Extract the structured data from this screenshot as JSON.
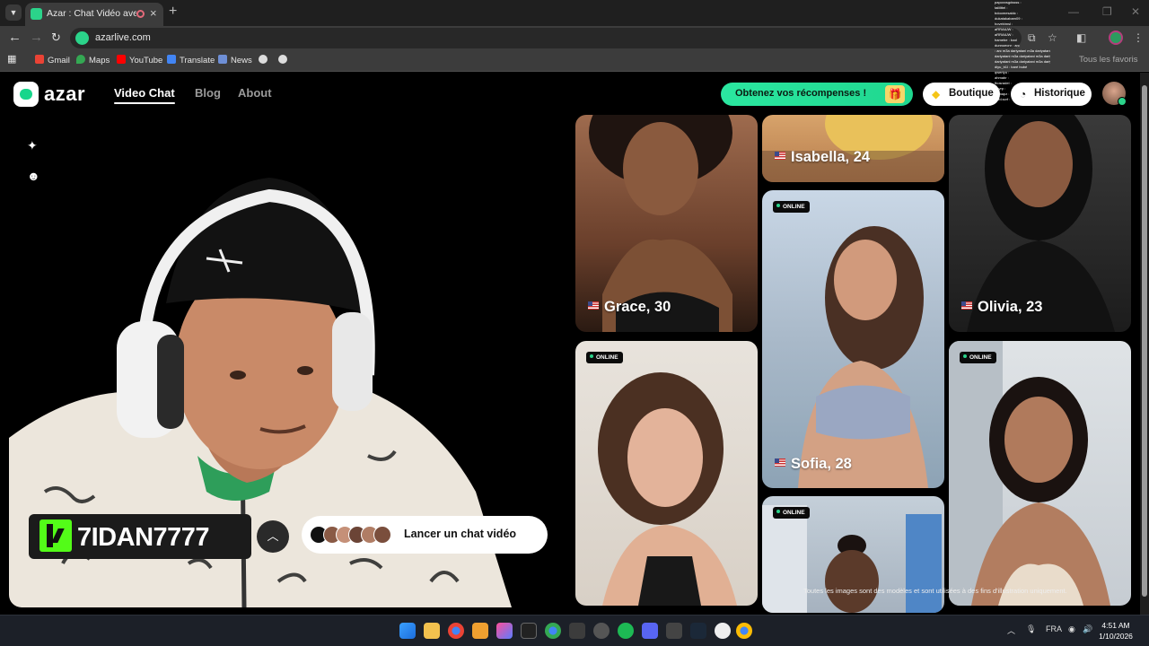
{
  "browser": {
    "tab_title": "Azar : Chat Vidéo avec de n",
    "url": "azarlive.com",
    "bookmarks": [
      "Gmail",
      "Maps",
      "YouTube",
      "Translate",
      "News"
    ],
    "bookmarks_right": "Tous les favoris"
  },
  "chat_overlay": [
    "papoxxsgdssss : ",
    "taiiilttel : ",
    "bdoomesaldc : ",
    "dukatakabam09 : ",
    "hovebimsl : ",
    "aRRAtUW : ",
    "aRRAtUW : ",
    "hamebe : kool",
    "dunnoecnr : arc",
    "          : arc m3a dariyatani m3a dariyatani m3a dariyatani m3a",
    "dariyatani m3a dariyatani m3a dariyatani m3a dariyatani m3a",
    "dariyatani m3a dariyatani m3a dariyatani m3a dariyatani",
    "diyu_b1l : baré bubé",
    "qwertyu : ",
    "ahmabr : ",
    "fbosradel : ",
    "boyrp : ",
    "anmapz : ",
    "atifd.scrf : "
  ],
  "site": {
    "logo_text": "azar",
    "nav": [
      "Video Chat",
      "Blog",
      "About"
    ],
    "rewards_label": "Obtenez vos récompenses !",
    "shop_label": "Boutique",
    "history_label": "Historique",
    "streamer_name": "7IDAN7777",
    "launch_label": "Lancer un chat vidéo",
    "disclaimer": "Toutes les images sont des modèles et sont utilisées à des fins d'illustration uniquement.",
    "online_badge": "ONLINE",
    "profiles": {
      "grace": "Grace, 30",
      "isabella": "Isabella, 24",
      "sofia": "Sofia, 28",
      "olivia": "Olivia, 23"
    }
  },
  "taskbar": {
    "lang": "FRA",
    "time": "4:51 AM",
    "date": "1/10/2026"
  }
}
